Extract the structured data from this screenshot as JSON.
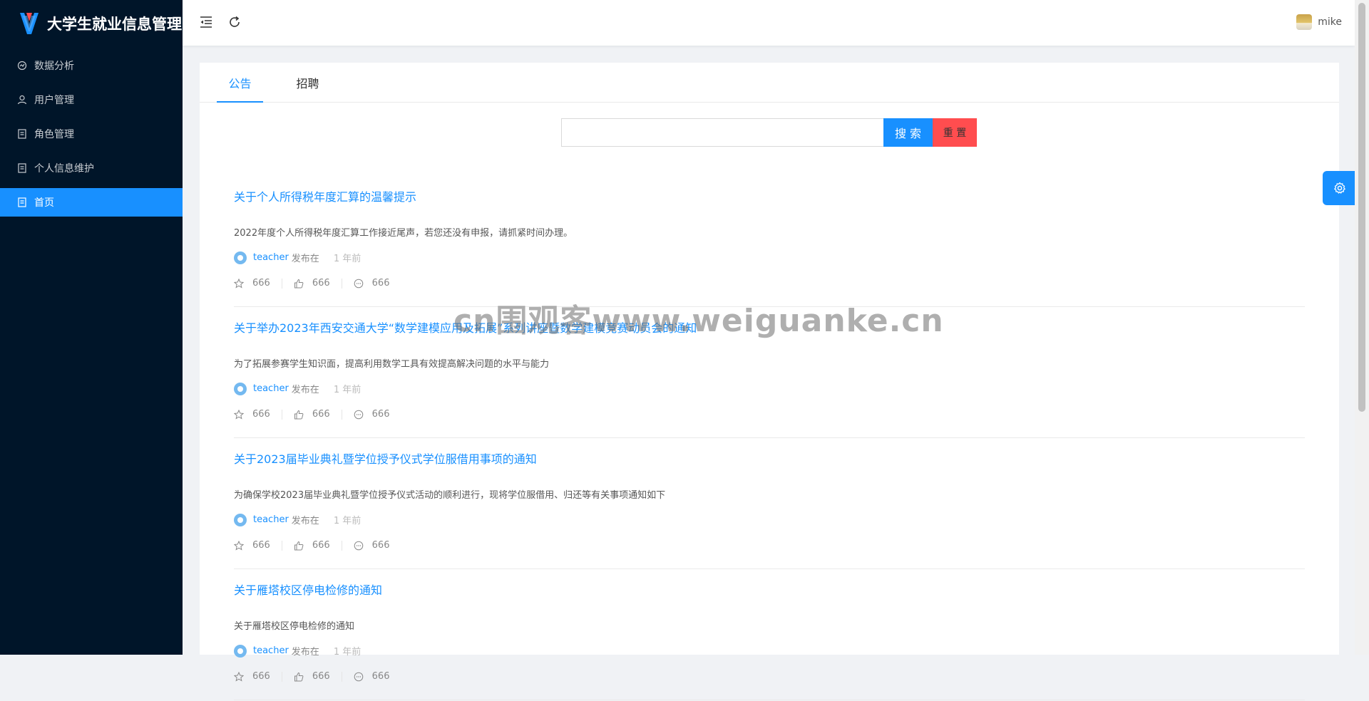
{
  "app": {
    "title": "大学生就业信息管理"
  },
  "sidebar": {
    "items": [
      {
        "label": "数据分析",
        "icon": "chart-icon",
        "active": false
      },
      {
        "label": "用户管理",
        "icon": "user-icon",
        "active": false
      },
      {
        "label": "角色管理",
        "icon": "document-icon",
        "active": false
      },
      {
        "label": "个人信息维护",
        "icon": "document-icon",
        "active": false
      },
      {
        "label": "首页",
        "icon": "document-icon",
        "active": true
      }
    ]
  },
  "header": {
    "username": "mike"
  },
  "tabs": [
    {
      "label": "公告",
      "active": true
    },
    {
      "label": "招聘",
      "active": false
    }
  ],
  "search": {
    "value": "",
    "placeholder": "",
    "search_label": "搜 索",
    "reset_label": "重 置"
  },
  "announcements": [
    {
      "title": "关于个人所得税年度汇算的温馨提示",
      "desc": "2022年度个人所得税年度汇算工作接近尾声，若您还没有申报，请抓紧时间办理。",
      "author": "teacher",
      "published_label": "发布在",
      "time": "1 年前",
      "stars": "666",
      "likes": "666",
      "comments": "666"
    },
    {
      "title": "关于举办2023年西安交通大学“数学建模应用及拓展”系列讲座暨数学建模竞赛动员会的通知",
      "desc": "为了拓展参赛学生知识面，提高利用数学工具有效提高解决问题的水平与能力",
      "author": "teacher",
      "published_label": "发布在",
      "time": "1 年前",
      "stars": "666",
      "likes": "666",
      "comments": "666"
    },
    {
      "title": "关于2023届毕业典礼暨学位授予仪式学位服借用事项的通知",
      "desc": "为确保学校2023届毕业典礼暨学位授予仪式活动的顺利进行，现将学位服借用、归还等有关事项通知如下",
      "author": "teacher",
      "published_label": "发布在",
      "time": "1 年前",
      "stars": "666",
      "likes": "666",
      "comments": "666"
    },
    {
      "title": "关于雁塔校区停电检修的通知",
      "desc": "关于雁塔校区停电检修的通知",
      "author": "teacher",
      "published_label": "发布在",
      "time": "1 年前",
      "stars": "666",
      "likes": "666",
      "comments": "666"
    }
  ],
  "watermark": "cn围观客www.weiguanke.cn",
  "colors": {
    "primary": "#1890ff",
    "sidebar_bg": "#001529",
    "danger": "#ff4d4f"
  }
}
